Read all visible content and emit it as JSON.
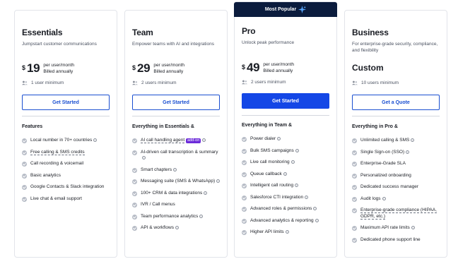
{
  "plans": [
    {
      "name": "Essentials",
      "description": "Jumpstart customer communications",
      "currency": "$",
      "price": "19",
      "price_unit": "per user/month",
      "billing": "Billed annually",
      "users": "1 user minimum",
      "cta": "Get Started",
      "features_heading": "Features",
      "features": [
        {
          "text": "Local number in 70+ countries",
          "info": true
        },
        {
          "text": "Free calling & SMS credits",
          "dashed": true
        },
        {
          "text": "Call recording & voicemail"
        },
        {
          "text": "Basic analytics"
        },
        {
          "text": "Google Contacts & Slack integration"
        },
        {
          "text": "Live chat & email support"
        }
      ]
    },
    {
      "name": "Team",
      "description": "Empower teams with AI and integrations",
      "currency": "$",
      "price": "29",
      "price_unit": "per user/month",
      "billing": "Billed annually",
      "users": "2 users minimum",
      "cta": "Get Started",
      "features_heading": "Everything in Essentials &",
      "features": [
        {
          "text": "AI call handling agent",
          "dashed": true,
          "badge": "add-on",
          "info": true
        },
        {
          "text": "AI-driven call transcription & summary",
          "info": true
        },
        {
          "text": "Smart chapters",
          "info": true
        },
        {
          "text": "Messaging suite (SMS & WhatsApp)",
          "info": true
        },
        {
          "text": "100+ CRM & data integrations",
          "info": true
        },
        {
          "text": "IVR / Call menus"
        },
        {
          "text": "Team performance analytics",
          "info": true
        },
        {
          "text": "API & workflows",
          "info": true
        }
      ]
    },
    {
      "name": "Pro",
      "banner": "Most Popular",
      "description": "Unlock peak performance",
      "currency": "$",
      "price": "49",
      "price_unit": "per user/month",
      "billing": "Billed annually",
      "users": "2 users minimum",
      "cta": "Get Started",
      "features_heading": "Everything in Team &",
      "features": [
        {
          "text": "Power dialer",
          "info": true
        },
        {
          "text": "Bulk SMS campaigns",
          "info": true
        },
        {
          "text": "Live call monitoring",
          "info": true
        },
        {
          "text": "Queue callback",
          "info": true
        },
        {
          "text": "Intelligent call routing",
          "info": true
        },
        {
          "text": "Salesforce CTI integration",
          "info": true
        },
        {
          "text": "Advanced roles & permissions",
          "info": true
        },
        {
          "text": "Advanced analytics & reporting",
          "info": true
        },
        {
          "text": "Higher API limits",
          "info": true
        }
      ]
    },
    {
      "name": "Business",
      "description": "For enterprise-grade security, compliance, and flexibility",
      "custom_price": "Custom",
      "users": "10 users minimum",
      "cta": "Get a Quote",
      "features_heading": "Everything in Pro &",
      "features": [
        {
          "text": "Unlimited calling & SMS",
          "info": true
        },
        {
          "text": "Single Sign-on (SSO)",
          "info": true
        },
        {
          "text": "Enterprise-Grade SLA"
        },
        {
          "text": "Personalized onboarding"
        },
        {
          "text": "Dedicated success manager"
        },
        {
          "text": "Audit logs",
          "info": true
        },
        {
          "text": "Enterprise-grade compliance (HIPAA, GDPR, etc.)",
          "dashed": true
        },
        {
          "text": "Maximum API rate limits",
          "info": true
        },
        {
          "text": "Dedicated phone support line"
        }
      ]
    }
  ],
  "colors": {
    "primary": "#1447e6",
    "banner": "#0b1c3d",
    "addon": "#6c2bd9"
  }
}
